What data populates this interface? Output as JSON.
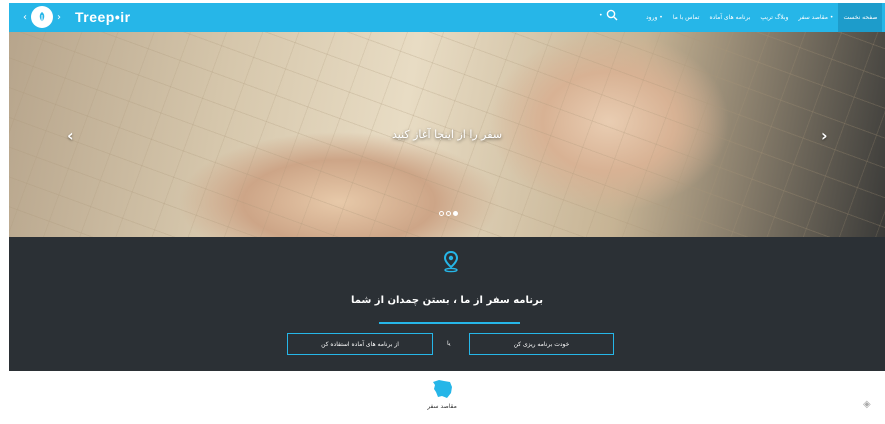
{
  "brand": {
    "name": "Treep•ir"
  },
  "nav": {
    "search_label": "•",
    "items": [
      {
        "label": "ورود •",
        "active": false
      },
      {
        "label": "تماس با ما",
        "active": false
      },
      {
        "label": "برنامه های آماده",
        "active": false
      },
      {
        "label": "وبلاگ تریپ",
        "active": false
      },
      {
        "label": "مقاصد سفر •",
        "active": false
      },
      {
        "label": "صفحه نخست",
        "active": true
      }
    ]
  },
  "hero": {
    "caption": "سفر را از اینجا آغاز کنید",
    "prev_arrow": "‹",
    "next_arrow": "›",
    "slide_count": 3,
    "active_slide": 3
  },
  "intro": {
    "tagline": "برنامه سفر از ما ، بستن چمدان از شما",
    "ready_button": "از برنامه های آماده استفاده کن",
    "or_label": "یا",
    "plan_button": "خودت برنامه ریزی کن"
  },
  "destinations": {
    "label": "مقاصد سفر"
  },
  "colors": {
    "accent": "#26b6e8",
    "dark_band": "#2b3035",
    "active_nav": "#1d9ccb"
  }
}
